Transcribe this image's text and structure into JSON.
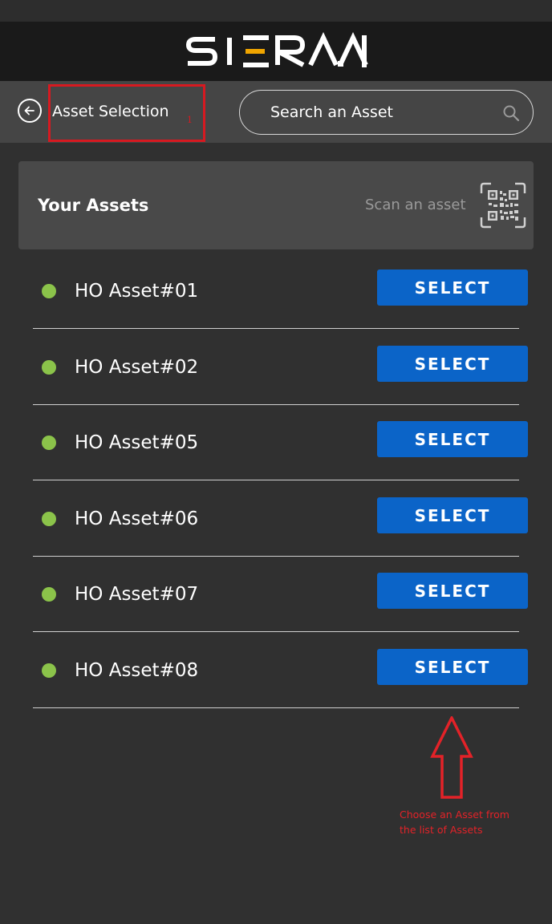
{
  "app": {
    "logo_text": "SIERA.AI",
    "logo_accent_color": "#f0a500"
  },
  "nav": {
    "title": "Asset Selection",
    "back_icon": "arrow-left-circle-icon",
    "highlight_number": "1",
    "highlight_color": "#d71920"
  },
  "search": {
    "placeholder": "Search an Asset",
    "value": "",
    "icon": "search-icon"
  },
  "assets_section": {
    "title": "Your Assets",
    "scan_label": "Scan an asset",
    "scan_icon": "qr-code-icon"
  },
  "assets": [
    {
      "name": "HO Asset#01",
      "status_color": "#8bc34a",
      "button_label": "SELECT"
    },
    {
      "name": "HO Asset#02",
      "status_color": "#8bc34a",
      "button_label": "SELECT"
    },
    {
      "name": "HO Asset#05",
      "status_color": "#8bc34a",
      "button_label": "SELECT"
    },
    {
      "name": "HO Asset#06",
      "status_color": "#8bc34a",
      "button_label": "SELECT"
    },
    {
      "name": "HO Asset#07",
      "status_color": "#8bc34a",
      "button_label": "SELECT"
    },
    {
      "name": "HO Asset#08",
      "status_color": "#8bc34a",
      "button_label": "SELECT"
    }
  ],
  "annotation": {
    "text": "Choose an Asset from\nthe list of Assets",
    "color": "#e32228",
    "icon": "arrow-up-icon"
  },
  "colors": {
    "background": "#303030",
    "brand_bar": "#1a1a1a",
    "nav_bar": "#454545",
    "header_card": "#494949",
    "select_button": "#0b64c8"
  }
}
